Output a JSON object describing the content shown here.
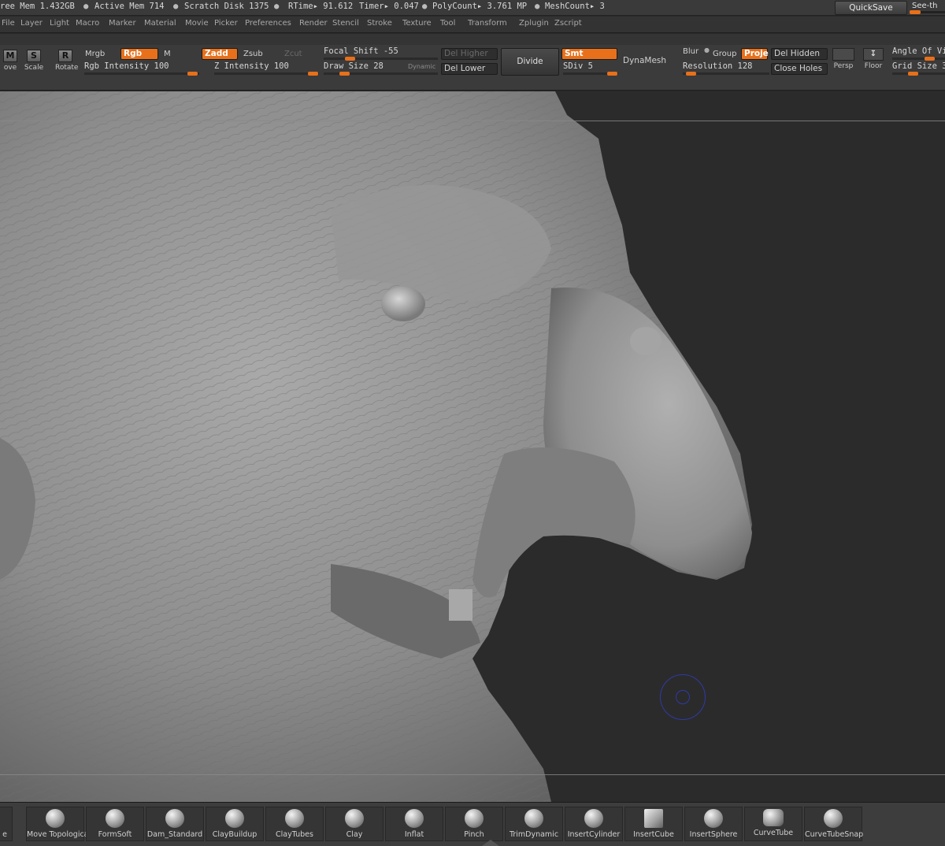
{
  "status": {
    "free_mem": "ree Mem 1.432GB",
    "active_mem": "Active Mem 714",
    "scratch_disk": "Scratch Disk 1375",
    "rtime": "RTime▸ 91.612",
    "timer": "Timer▸ 0.047",
    "polycount": "PolyCount▸ 3.761  MP",
    "meshcount": "MeshCount▸ 3",
    "quicksave": "QuickSave",
    "see_through": "See-th"
  },
  "menu": [
    "File",
    "Layer",
    "Light",
    "Macro",
    "Marker",
    "Material",
    "Movie",
    "Picker",
    "Preferences",
    "Render",
    "Stencil",
    "Stroke",
    "Texture",
    "Tool",
    "Transform",
    "Zplugin",
    "Zscript"
  ],
  "shelf": {
    "move": "ove",
    "scale": "Scale",
    "rotate": "Rotate",
    "mrgb": "Mrgb",
    "rgb": "Rgb",
    "m": "M",
    "rgb_intensity": "Rgb Intensity 100",
    "rgb_intensity_value": 100,
    "zadd": "Zadd",
    "zsub": "Zsub",
    "zcut": "Zcut",
    "z_intensity": "Z Intensity 100",
    "z_intensity_value": 100,
    "focal_shift": "Focal Shift -55",
    "focal_shift_value": -55,
    "draw_size": "Draw Size 28",
    "draw_size_value": 28,
    "dynamic": "Dynamic",
    "del_higher": "Del Higher",
    "del_lower": "Del Lower",
    "divide": "Divide",
    "smt": "Smt",
    "sdiv": "SDiv 5",
    "dynamesh": "DynaMesh",
    "blur": "Blur",
    "group": "Group",
    "proje": "Proje",
    "resolution": "Resolution 128",
    "resolution_value": 128,
    "del_hidden": "Del Hidden",
    "close_holes": "Close Holes",
    "persp": "Persp",
    "floor": "Floor",
    "angle_of_view": "Angle Of Vi",
    "grid_size": "Grid Size 3"
  },
  "brushes": [
    "e",
    "Move Topologica",
    "FormSoft",
    "Dam_Standard",
    "ClayBuildup",
    "ClayTubes",
    "Clay",
    "Inflat",
    "Pinch",
    "TrimDynamic",
    "InsertCylinder",
    "InsertCube",
    "InsertSphere",
    "CurveTube",
    "CurveTubeSnap"
  ],
  "colors": {
    "accent": "#e8701a",
    "ui_bg": "#3b3b3b",
    "viewport_bg": "#2b2b2b",
    "cursor_ring": "#2f3aa8"
  }
}
